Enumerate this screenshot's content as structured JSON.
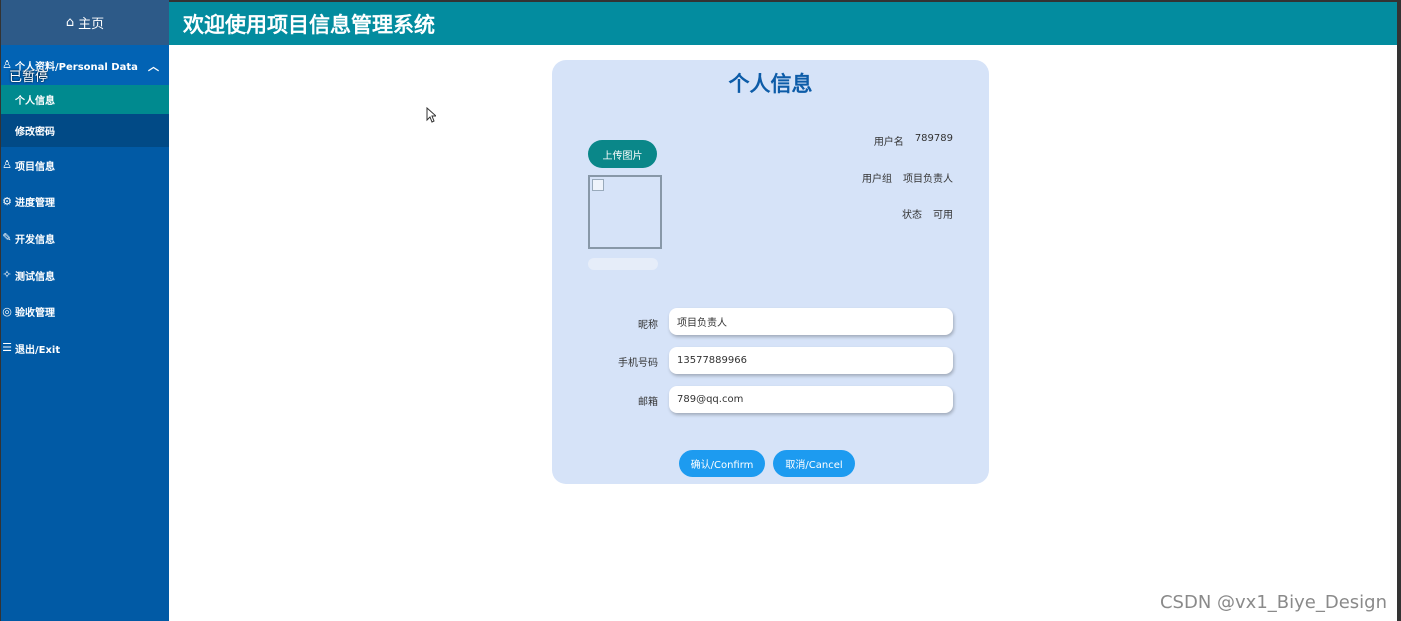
{
  "header": {
    "title": "欢迎使用项目信息管理系统"
  },
  "sidebar": {
    "home_label": "主页",
    "section_label": "个人资料/Personal Data",
    "paused_label": "已暂停",
    "sub_items": [
      {
        "label": "个人信息"
      },
      {
        "label": "修改密码"
      }
    ],
    "nav_items": [
      {
        "label": "项目信息"
      },
      {
        "label": "进度管理"
      },
      {
        "label": "开发信息"
      },
      {
        "label": "测试信息"
      },
      {
        "label": "验收管理"
      },
      {
        "label": "退出/Exit"
      }
    ]
  },
  "card": {
    "title": "个人信息",
    "upload_label": "上传图片",
    "info": [
      {
        "label": "用户名",
        "value": "789789"
      },
      {
        "label": "用户组",
        "value": "项目负责人"
      },
      {
        "label": "状态",
        "value": "可用"
      }
    ],
    "form": [
      {
        "label": "昵称",
        "value": "项目负责人"
      },
      {
        "label": "手机号码",
        "value": "13577889966"
      },
      {
        "label": "邮箱",
        "value": "789@qq.com"
      }
    ],
    "confirm_label": "确认/Confirm",
    "cancel_label": "取消/Cancel"
  },
  "watermark": "CSDN @vx1_Biye_Design",
  "colors": {
    "sidebar_bg": "#015aa5",
    "header_bg": "#038c9f",
    "active_item": "#008a8f",
    "card_bg": "#d6e3f8",
    "title_color": "#0d5ca8",
    "button_blue": "#1d9bf0",
    "upload_teal": "#0a8789"
  }
}
